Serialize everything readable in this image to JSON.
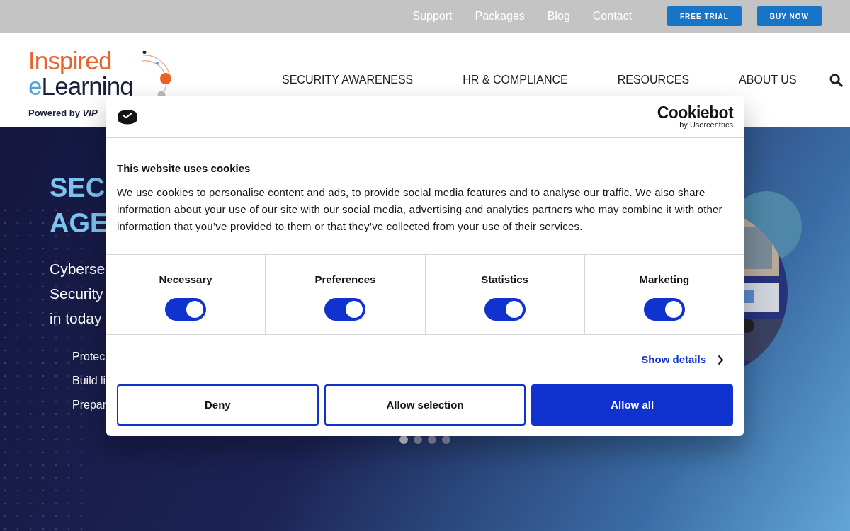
{
  "top_links": [
    "Support",
    "Packages",
    "Blog",
    "Contact"
  ],
  "top_buttons": [
    "FREE TRIAL",
    "BUY NOW"
  ],
  "logo": {
    "line_1": "Inspired",
    "line_2_a": "e",
    "line_2_b": "Learning",
    "powered": "Powered by",
    "brand": "VIP"
  },
  "nav": [
    "SECURITY AWARENESS",
    "HR & COMPLIANCE",
    "RESOURCES",
    "ABOUT US"
  ],
  "hero": {
    "heading": [
      "SEC",
      "AGE"
    ],
    "intro": [
      "Cyberse",
      "Security",
      "in today"
    ],
    "bullets": [
      "Protec",
      "Build li",
      "Prepar"
    ]
  },
  "carousel_dots": [
    {
      "selected": true
    },
    {
      "selected": false
    },
    {
      "selected": false
    },
    {
      "selected": false
    }
  ],
  "dialog": {
    "brand": "Cookiebot",
    "brand_sub": "by Usercentrics",
    "title": "This website uses cookies",
    "text": "We use cookies to personalise content and ads, to provide social media features and to analyse our traffic. We also share information about your use of our site with our social media, advertising and analytics partners who may combine it with other information that you’ve provided to them or that they’ve collected from your use of their services.",
    "categories": [
      {
        "label": "Necessary",
        "on": true
      },
      {
        "label": "Preferences",
        "on": true
      },
      {
        "label": "Statistics",
        "on": true
      },
      {
        "label": "Marketing",
        "on": true
      }
    ],
    "details_link": "Show details",
    "buttons": [
      {
        "label": "Deny",
        "kind": "outline"
      },
      {
        "label": "Allow selection",
        "kind": "outline"
      },
      {
        "label": "Allow all",
        "kind": "primary"
      }
    ]
  }
}
